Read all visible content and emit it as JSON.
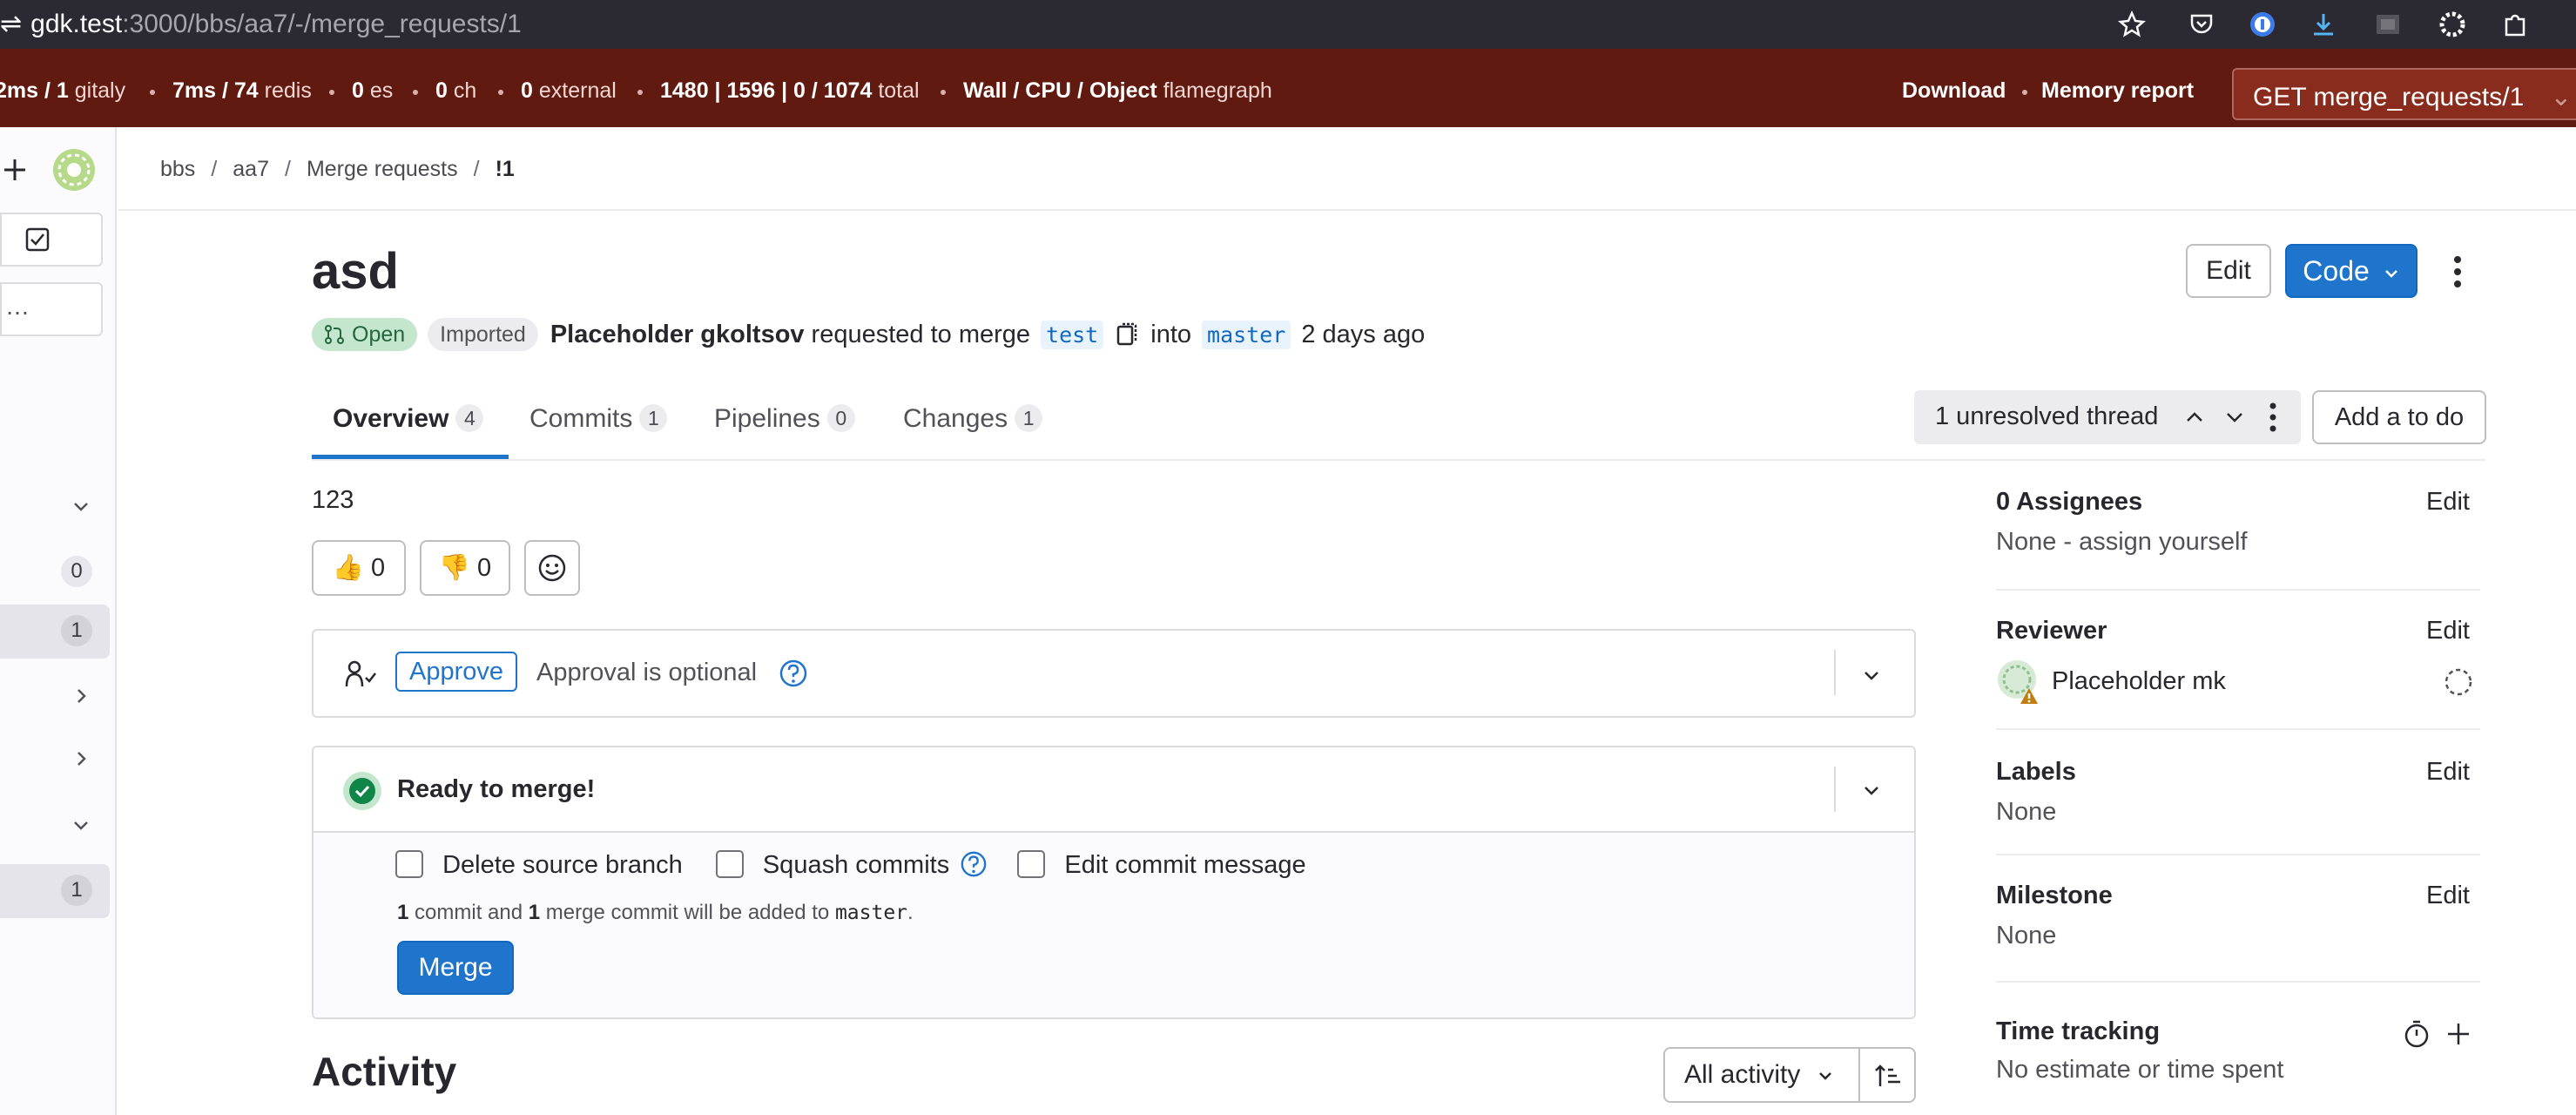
{
  "browser": {
    "url_host": "gdk.test",
    "url_path": ":3000/bbs/aa7/-/merge_requests/1",
    "icons": [
      "star-icon",
      "pocket-icon",
      "password-manager-icon",
      "download-icon",
      "extension-icon",
      "settings-icon",
      "puzzle-icon"
    ]
  },
  "perfbar": {
    "items": [
      {
        "value": "2ms / 1",
        "label": "gitaly"
      },
      {
        "value": "7ms / 74",
        "label": "redis"
      },
      {
        "value": "0",
        "label": "es"
      },
      {
        "value": "0",
        "label": "ch"
      },
      {
        "value": "0",
        "label": "external"
      },
      {
        "value": "1480 | 1596 | 0 / 1074",
        "label": "total"
      },
      {
        "value": "Wall / CPU / Object",
        "label": "flamegraph"
      }
    ],
    "download": "Download",
    "memory_report": "Memory report",
    "request": "GET merge_requests/1"
  },
  "sidebar": {
    "badges": [
      "0",
      "1",
      "1"
    ]
  },
  "breadcrumbs": [
    "bbs",
    "aa7",
    "Merge requests",
    "!1"
  ],
  "mr": {
    "title": "asd",
    "edit_label": "Edit",
    "code_label": "Code",
    "status": "Open",
    "imported": "Imported",
    "author": "Placeholder gkoltsov",
    "requested_text": "requested to merge",
    "source_branch": "test",
    "into_text": "into",
    "target_branch": "master",
    "time_ago": "2 days ago"
  },
  "tabs": [
    {
      "label": "Overview",
      "count": "4"
    },
    {
      "label": "Commits",
      "count": "1"
    },
    {
      "label": "Pipelines",
      "count": "0"
    },
    {
      "label": "Changes",
      "count": "1"
    }
  ],
  "threads": {
    "label": "1 unresolved thread",
    "todo_label": "Add a to do"
  },
  "description": "123",
  "reactions": {
    "thumbs_up": "0",
    "thumbs_down": "0"
  },
  "approval": {
    "approve_label": "Approve",
    "optional_text": "Approval is optional"
  },
  "merge": {
    "ready_text": "Ready to merge!",
    "delete_source": "Delete source branch",
    "squash": "Squash commits",
    "edit_message": "Edit commit message",
    "commit_count": "1",
    "commit_text": "commit and",
    "merge_commit_count": "1",
    "merge_commit_text": "merge commit will be added to",
    "target": "master",
    "period": ".",
    "merge_button": "Merge"
  },
  "activity": {
    "title": "Activity",
    "filter": "All activity"
  },
  "right_sidebar": {
    "assignees_title": "0 Assignees",
    "assignees_value": "None - assign yourself",
    "reviewer_title": "Reviewer",
    "reviewer_name": "Placeholder mk",
    "labels_title": "Labels",
    "labels_value": "None",
    "milestone_title": "Milestone",
    "milestone_value": "None",
    "time_title": "Time tracking",
    "time_value": "No estimate or time spent",
    "edit_label": "Edit"
  },
  "colors": {
    "perfbar_bg": "#611a0f",
    "primary": "#1f75cb",
    "success": "#108548",
    "warning": "#c17d10"
  }
}
